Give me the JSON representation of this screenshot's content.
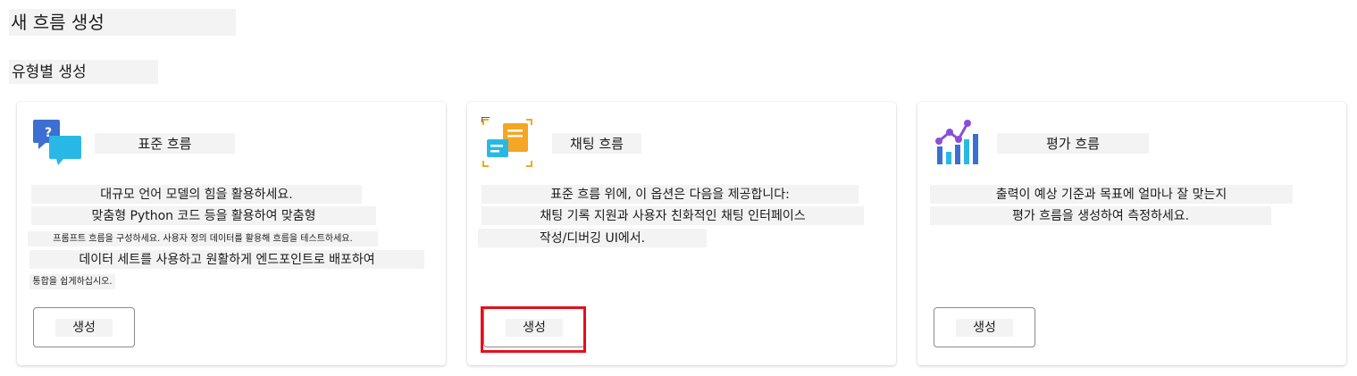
{
  "page": {
    "title": "새 흐름 생성",
    "section_title": "유형별 생성"
  },
  "cards": [
    {
      "title": "표준 흐름",
      "icon": "chat-question-icon",
      "description": [
        "대규모 언어 모델의 힘을 활용하세요.",
        "맞춤형 Python 코드 등을 활용하여 맞춤형",
        "프롬프트 흐름을 구성하세요. 사용자 정의 데이터를 활용해 흐름을 테스트하세요.",
        "데이터 세트를 사용하고 원활하게 엔드포인트로 배포하여",
        "통합을 쉽게하십시오."
      ],
      "button_label": "생성"
    },
    {
      "title": "채팅 흐름",
      "icon": "chat-document-icon",
      "description": [
        "표준 흐름 위에, 이 옵션은 다음을 제공합니다:",
        "채팅 기록 지원과 사용자 친화적인 채팅 인터페이스",
        "작성/디버깅 UI에서."
      ],
      "button_label": "생성"
    },
    {
      "title": "평가 흐름",
      "icon": "chart-evaluation-icon",
      "description": [
        "출력이 예상 기준과 목표에 얼마나 잘 맞는지",
        "평가 흐름을 생성하여 측정하세요."
      ],
      "button_label": "생성"
    }
  ],
  "colors": {
    "highlight": "#e3101b",
    "text_bg": "#f3f3f3"
  }
}
